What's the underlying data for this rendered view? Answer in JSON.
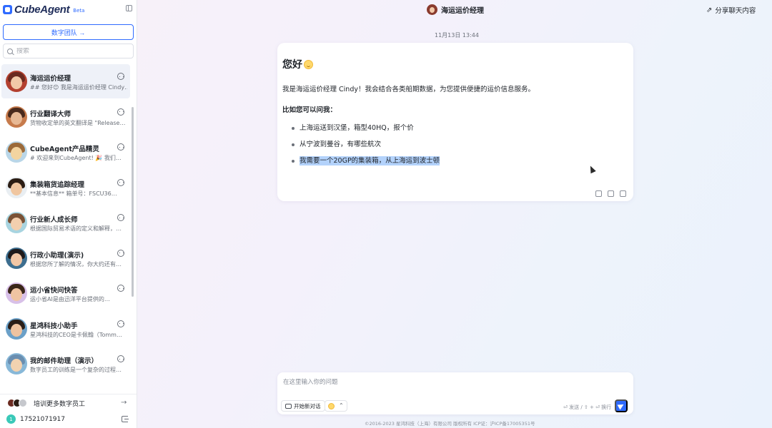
{
  "brand": {
    "name": "CubeAgent",
    "badge": "Beta"
  },
  "sidebar": {
    "team_button": "数字团队 →",
    "search_placeholder": "搜索",
    "agents": [
      {
        "name": "海运运价经理",
        "preview": "## 您好😊 我是海运运价经理 Cindy…",
        "active": true,
        "colors": [
          "#6b2a20",
          "#f2c9a8",
          "#b3402f"
        ]
      },
      {
        "name": "行业翻译大师",
        "preview": "货物收定单的英文翻译是 \"Release…",
        "active": false,
        "colors": [
          "#4a2a1c",
          "#e8b995",
          "#c77b4c"
        ]
      },
      {
        "name": "CubeAgent产品精灵",
        "preview": "# 欢迎来到CubeAgent! 🎉 我们…",
        "active": false,
        "colors": [
          "#9b6a3a",
          "#f3d4a0",
          "#b9d6e8"
        ]
      },
      {
        "name": "集装箱货追踪经理",
        "preview": "**基本信息** 箱单号：FSCU36…",
        "active": false,
        "colors": [
          "#2b1d14",
          "#f0c6a0",
          "#e9eef2"
        ]
      },
      {
        "name": "行业新人成长师",
        "preview": "根据国际贸易术语的定义和解释，…",
        "active": false,
        "colors": [
          "#7a5236",
          "#f3cfae",
          "#a8d4e0"
        ]
      },
      {
        "name": "行政小助理(演示)",
        "preview": "根据您所了解的情况，你大约还有…",
        "active": false,
        "colors": [
          "#1f1a1a",
          "#f2c7a5",
          "#3d6e8f"
        ]
      },
      {
        "name": "运小省快问快答",
        "preview": "运小省AI是由迅洋平台提供的…",
        "active": false,
        "colors": [
          "#3a2618",
          "#f0c4a2",
          "#d8c0e8"
        ]
      },
      {
        "name": "星鸿科技小助手",
        "preview": "星鸿科技的CEO是卡佩翰（Tomm…",
        "active": false,
        "colors": [
          "#2a1e18",
          "#efc3a0",
          "#6ba0c8"
        ]
      },
      {
        "name": "我的邮件助理（演示）",
        "preview": "数字员工的训练是一个复杂的过程…",
        "active": false,
        "colors": [
          "#6a8eb0",
          "#f2d2b0",
          "#88b8d8"
        ]
      }
    ],
    "train_label": "培训更多数字员工",
    "user_phone": "17521071917",
    "user_initial": "1"
  },
  "chat": {
    "title": "海运运价经理",
    "share_label": "分享聊天内容",
    "timestamp": "11月13日 13:44",
    "message": {
      "greeting": "您好",
      "intro": "我是海运运价经理 Cindy！我会结合各类船期数据，为您提供便捷的运价信息服务。",
      "sub": "比如您可以问我：",
      "examples": [
        "上海运送到汉堡，箱型40HQ，报个价",
        "从宁波到曼谷，有哪些航次",
        "我需要一个20GP的集装箱，从上海运到波士顿"
      ]
    }
  },
  "composer": {
    "placeholder": "在这里输入你的问题",
    "new_chat_label": "开始新对话",
    "hint": "⏎ 发送 / ⇧ + ⏎ 换行",
    "footer": "©2016-2023 星鸿科技（上海）有限公司 版权所有 ICP证：沪ICP备17005351号"
  },
  "colors": {
    "accent": "#2f6bff",
    "selection": "#b3d2fb"
  }
}
